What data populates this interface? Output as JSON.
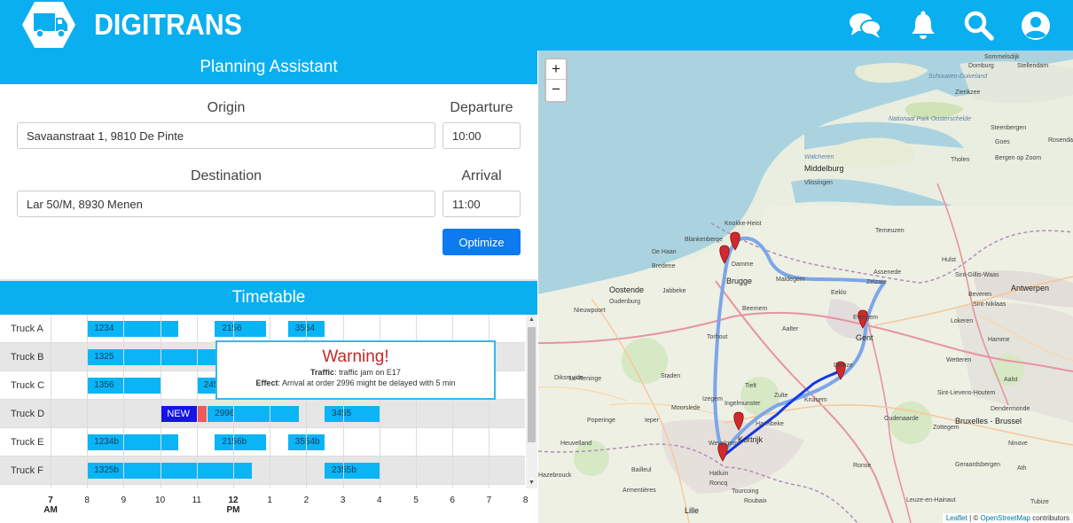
{
  "header": {
    "brand": "DIGITRANS",
    "colors": {
      "bar": "#0aafef",
      "text": "#ffffff"
    },
    "icons": [
      "chat-icon",
      "bell-icon",
      "search-icon",
      "user-icon"
    ]
  },
  "planner": {
    "title": "Planning Assistant",
    "origin_label": "Origin",
    "origin_value": "Savaanstraat 1, 9810 De Pinte",
    "departure_label": "Departure",
    "departure_value": "10:00",
    "destination_label": "Destination",
    "destination_value": "Lar 50/M, 8930 Menen",
    "arrival_label": "Arrival",
    "arrival_value": "11:00",
    "optimize_label": "Optimize"
  },
  "timetable": {
    "title": "Timetable",
    "rows": [
      {
        "name": "Truck A",
        "orders": [
          {
            "label": "1234",
            "start": 8,
            "end": 10.5
          },
          {
            "label": "2156",
            "start": 11.5,
            "end": 12.9
          },
          {
            "label": "3554",
            "start": 13.5,
            "end": 14.5
          }
        ]
      },
      {
        "name": "Truck B",
        "orders": [
          {
            "label": "1325",
            "start": 8,
            "end": 11.6
          }
        ]
      },
      {
        "name": "Truck C",
        "orders": [
          {
            "label": "1356",
            "start": 8,
            "end": 10
          },
          {
            "label": "245",
            "start": 11,
            "end": 11.6
          }
        ]
      },
      {
        "name": "Truck D",
        "orders": [
          {
            "label": "NEW",
            "start": 10,
            "end": 11,
            "kind": "new"
          },
          {
            "label": "",
            "start": 11,
            "end": 11.3,
            "kind": "delay"
          },
          {
            "label": "2996",
            "start": 11.3,
            "end": 13.8
          },
          {
            "label": "3455",
            "start": 14.5,
            "end": 16
          }
        ]
      },
      {
        "name": "Truck E",
        "orders": [
          {
            "label": "1234b",
            "start": 8,
            "end": 10.5
          },
          {
            "label": "2156b",
            "start": 11.5,
            "end": 12.9
          },
          {
            "label": "3554b",
            "start": 13.5,
            "end": 14.5
          }
        ]
      },
      {
        "name": "Truck F",
        "orders": [
          {
            "label": "1325b",
            "start": 8,
            "end": 12.5
          },
          {
            "label": "2355b",
            "start": 14.5,
            "end": 16
          }
        ]
      }
    ],
    "axis": [
      {
        "hour": 7,
        "label": "7",
        "sub": "AM"
      },
      {
        "hour": 8,
        "label": "8"
      },
      {
        "hour": 9,
        "label": "9"
      },
      {
        "hour": 10,
        "label": "10"
      },
      {
        "hour": 11,
        "label": "11"
      },
      {
        "hour": 12,
        "label": "12",
        "sub": "PM"
      },
      {
        "hour": 13,
        "label": "1"
      },
      {
        "hour": 14,
        "label": "2"
      },
      {
        "hour": 15,
        "label": "3"
      },
      {
        "hour": 16,
        "label": "4"
      },
      {
        "hour": 17,
        "label": "5"
      },
      {
        "hour": 18,
        "label": "6"
      },
      {
        "hour": 19,
        "label": "7"
      },
      {
        "hour": 20,
        "label": "8"
      }
    ],
    "colors": {
      "order": "#0ab4f5",
      "new": "#1414e6",
      "delay": "#f05a5a"
    }
  },
  "warning": {
    "title": "Warning!",
    "traffic_label": "Traffic",
    "traffic_text": ": traffic jam on E17",
    "effect_label": "Effect",
    "effect_text": ": Arrival at order 2996 might be delayed with 5 min"
  },
  "map": {
    "zoom_in": "+",
    "zoom_out": "−",
    "attribution_leaflet": "Leaflet",
    "attribution_sep": " | © ",
    "attribution_osm": "OpenStreetMap",
    "attribution_tail": " contributors",
    "places": [
      {
        "name": "Sommelsdijk"
      },
      {
        "name": "Stellendam"
      },
      {
        "name": "Schouwen-Duiveland"
      },
      {
        "name": "Zierikzee"
      },
      {
        "name": "Domburg"
      },
      {
        "name": "Walcheren"
      },
      {
        "name": "Middelburg"
      },
      {
        "name": "Vlissingen"
      },
      {
        "name": "Nationaal Park Oosterschelde"
      },
      {
        "name": "Tholen"
      },
      {
        "name": "Steenbergen"
      },
      {
        "name": "Rosendaal"
      },
      {
        "name": "Bergen op Zoom"
      },
      {
        "name": "Goes"
      },
      {
        "name": "Knokke-Heist"
      },
      {
        "name": "Blankenberge"
      },
      {
        "name": "De Haan"
      },
      {
        "name": "Damme"
      },
      {
        "name": "Bredene"
      },
      {
        "name": "Oostende"
      },
      {
        "name": "Brugge"
      },
      {
        "name": "Maldegem"
      },
      {
        "name": "Assenede"
      },
      {
        "name": "Zelzate"
      },
      {
        "name": "Terneuzen"
      },
      {
        "name": "Hulst"
      },
      {
        "name": "Antwerpen"
      },
      {
        "name": "Sint-Gillis-Waas"
      },
      {
        "name": "Beveren"
      },
      {
        "name": "Sint-Niklaas"
      },
      {
        "name": "Oudenburg"
      },
      {
        "name": "Jabbeke"
      },
      {
        "name": "Eeklo"
      },
      {
        "name": "Nieuwpoort"
      },
      {
        "name": "Torhout"
      },
      {
        "name": "Beernem"
      },
      {
        "name": "Aalter"
      },
      {
        "name": "Evergem"
      },
      {
        "name": "Lokeren"
      },
      {
        "name": "Hamme"
      },
      {
        "name": "Diksmuide"
      },
      {
        "name": "Tielt"
      },
      {
        "name": "Gent"
      },
      {
        "name": "Wetteren"
      },
      {
        "name": "Dendermonde"
      },
      {
        "name": "Lo-Reninge"
      },
      {
        "name": "Staden"
      },
      {
        "name": "Deinze"
      },
      {
        "name": "Zulte"
      },
      {
        "name": "Sint-Lievens-Houtem"
      },
      {
        "name": "Moorslede"
      },
      {
        "name": "Izegem"
      },
      {
        "name": "Ingelmunster"
      },
      {
        "name": "Kruisem"
      },
      {
        "name": "Zottegem"
      },
      {
        "name": "Aalst"
      },
      {
        "name": "Poperinge"
      },
      {
        "name": "Ieper"
      },
      {
        "name": "Harelbeke"
      },
      {
        "name": "Kortrijk"
      },
      {
        "name": "Oudenaarde"
      },
      {
        "name": "Ninove"
      },
      {
        "name": "Heuvelland"
      },
      {
        "name": "Wevelgem"
      },
      {
        "name": "Geraardsbergen"
      },
      {
        "name": "Bruxelles - Brussel"
      },
      {
        "name": "Bailleul"
      },
      {
        "name": "Halluin"
      },
      {
        "name": "Ronse"
      },
      {
        "name": "Hazebrouck"
      },
      {
        "name": "Roncq"
      },
      {
        "name": "Tourcoing"
      },
      {
        "name": "Roubaix"
      },
      {
        "name": "Ath"
      },
      {
        "name": "Armentières"
      },
      {
        "name": "Leuze-en-Hainaut"
      },
      {
        "name": "Lille"
      },
      {
        "name": "Tubize"
      }
    ]
  }
}
